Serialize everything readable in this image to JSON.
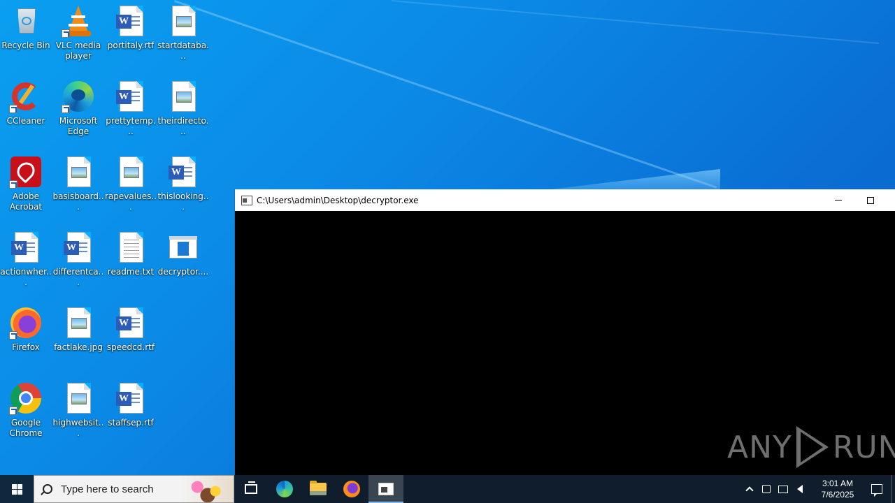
{
  "desktop": {
    "icons": [
      {
        "label": "Recycle Bin",
        "icon": "recycle-bin-icon"
      },
      {
        "label": "VLC media player",
        "icon": "vlc-icon"
      },
      {
        "label": "portitaly.rtf",
        "icon": "word-document-icon"
      },
      {
        "label": "startdataba...",
        "icon": "image-file-icon"
      },
      {
        "label": "CCleaner",
        "icon": "ccleaner-icon"
      },
      {
        "label": "Microsoft Edge",
        "icon": "edge-icon"
      },
      {
        "label": "prettytemp...",
        "icon": "word-document-icon"
      },
      {
        "label": "theirdirecto...",
        "icon": "image-file-icon"
      },
      {
        "label": "Adobe Acrobat",
        "icon": "acrobat-icon"
      },
      {
        "label": "basisboard...",
        "icon": "image-file-icon"
      },
      {
        "label": "rapevalues...",
        "icon": "image-file-icon"
      },
      {
        "label": "thislooking...",
        "icon": "word-document-icon"
      },
      {
        "label": "actionwher...",
        "icon": "word-document-icon"
      },
      {
        "label": "differentca...",
        "icon": "word-document-icon"
      },
      {
        "label": "readme.txt",
        "icon": "text-file-icon"
      },
      {
        "label": "decryptor....",
        "icon": "executable-icon"
      },
      {
        "label": "Firefox",
        "icon": "firefox-icon"
      },
      {
        "label": "factlake.jpg",
        "icon": "image-file-icon"
      },
      {
        "label": "speedcd.rtf",
        "icon": "word-document-icon"
      },
      {
        "label": "Google Chrome",
        "icon": "chrome-icon"
      },
      {
        "label": "highwebsit...",
        "icon": "image-file-icon"
      },
      {
        "label": "staffsep.rtf",
        "icon": "word-document-icon"
      }
    ]
  },
  "console_window": {
    "title": "C:\\Users\\admin\\Desktop\\decryptor.exe"
  },
  "watermark": {
    "text_left": "ANY",
    "text_right": "RUN"
  },
  "taskbar": {
    "search_placeholder": "Type here to search",
    "clock_time": "3:01 AM",
    "clock_date": "7/6/2025"
  }
}
